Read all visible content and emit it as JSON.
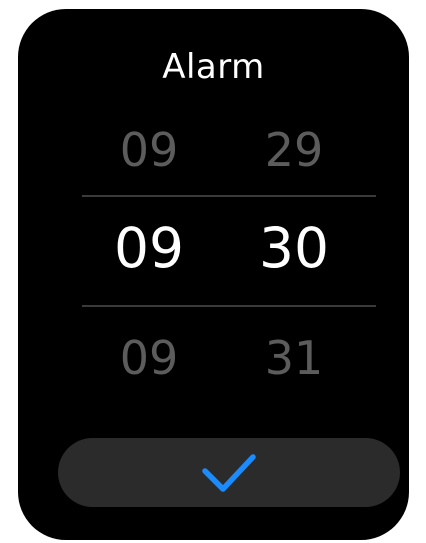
{
  "screen": {
    "title": "Alarm"
  },
  "picker": {
    "previous": {
      "hour": "09",
      "minute": "29"
    },
    "selected": {
      "hour": "09",
      "minute": "30"
    },
    "next": {
      "hour": "09",
      "minute": "31"
    }
  },
  "confirm": {
    "icon": "checkmark-icon",
    "icon_color": "#1a8cff"
  },
  "colors": {
    "background": "#000000",
    "selected_text": "#ffffff",
    "faded_text": "#5c5c5c",
    "button_background": "#2b2b2b"
  }
}
